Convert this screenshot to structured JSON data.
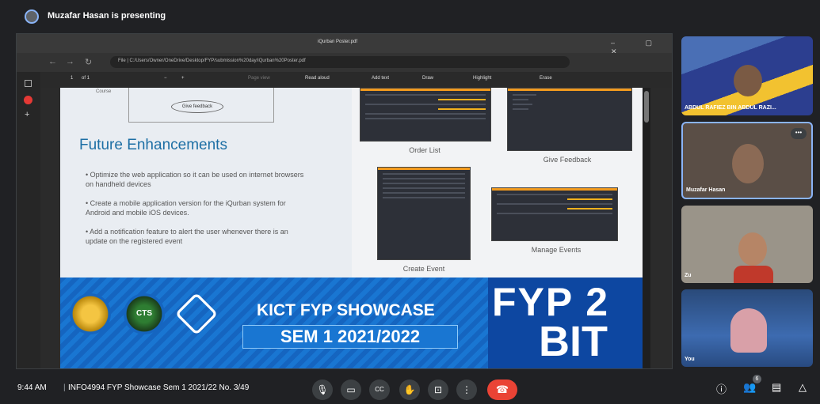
{
  "header": {
    "presenter_label": "Muzafar Hasan is presenting"
  },
  "browser": {
    "tab_title": "iQurban Poster.pdf",
    "window_controls": "– ▢ ✕",
    "url": "File | C:/Users/Owner/OneDrive/Desktop/FYP/submission%20day/iQurban%20Poster.pdf",
    "back_icon": "←",
    "forward_icon": "→",
    "reload_icon": "↻"
  },
  "pdf_toolbar": {
    "page_num": "1",
    "page_of": "of 1",
    "zoom_out": "−",
    "zoom_in": "+",
    "page_view": "Page view",
    "read_aloud": "Read aloud",
    "add_text": "Add text",
    "draw": "Draw",
    "highlight": "Highlight",
    "erase": "Erase"
  },
  "poster": {
    "course_fragment": "Course",
    "give_feedback_oval": "Give feedback",
    "future_title": "Future Enhancements",
    "bullets": [
      "Optimize the web application so it can be used on internet browsers on handheld devices",
      "Create a mobile application version for the iQurban system for Android and mobile iOS devices.",
      "Add a notification feature to alert the user whenever there is an update on the registered event"
    ],
    "captions": {
      "order_list": "Order List",
      "give_feedback": "Give Feedback",
      "create_event": "Create Event",
      "manage_events": "Manage Events"
    },
    "banner": {
      "showcase": "KICT FYP SHOWCASE",
      "semester": "SEM 1 2021/2022",
      "fyp2": "FYP 2",
      "bit": "BIT",
      "logo_center_text": "CTS"
    }
  },
  "participants": [
    {
      "name": "ABDUL RAFIEZ BIN ABDUL RAZI..."
    },
    {
      "name": "Muzafar Hasan"
    },
    {
      "name": "Zu"
    },
    {
      "name": "You"
    }
  ],
  "bottom_bar": {
    "time": "9:44 AM",
    "meeting_name": "INFO4994 FYP Showcase Sem 1 2021/22 No. 3/49",
    "participant_count": "6"
  },
  "colors": {
    "accent_orange": "#f29a1e",
    "banner_blue": "#1565c0",
    "end_call_red": "#ea4335",
    "title_blue": "#1d6fa5"
  }
}
